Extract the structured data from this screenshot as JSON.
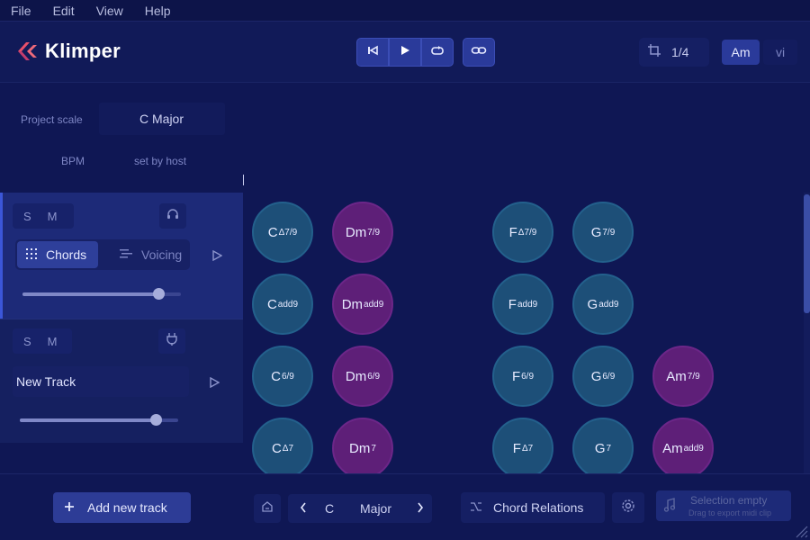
{
  "menu": [
    "File",
    "Edit",
    "View",
    "Help"
  ],
  "app": {
    "name": "Klimper"
  },
  "transport": {
    "quantize": "1/4",
    "keys": [
      "Am",
      "vi"
    ]
  },
  "project": {
    "scale_label": "Project scale",
    "scale_value": "C Major",
    "bpm_label": "BPM",
    "bpm_value": "set by host"
  },
  "tracks": [
    {
      "solo": "S",
      "mute": "M",
      "mode_on": "Chords",
      "mode_off": "Voicing",
      "volume": 0.86
    },
    {
      "solo": "S",
      "mute": "M",
      "name": "New Track",
      "volume": 0.86
    }
  ],
  "chords": [
    {
      "root": "C",
      "ext": "Δ7/9",
      "color": "teal"
    },
    {
      "root": "Dm",
      "ext": "7/9",
      "color": "purple"
    },
    {
      "root": "F",
      "ext": "Δ7/9",
      "color": "teal"
    },
    {
      "root": "G",
      "ext": "7/9",
      "color": "teal"
    },
    {
      "root": "C",
      "ext": "add9",
      "color": "teal"
    },
    {
      "root": "Dm",
      "ext": "add9",
      "color": "purple"
    },
    {
      "root": "F",
      "ext": "add9",
      "color": "teal"
    },
    {
      "root": "G",
      "ext": "add9",
      "color": "teal"
    },
    {
      "root": "C",
      "ext": "6/9",
      "color": "teal"
    },
    {
      "root": "Dm",
      "ext": "6/9",
      "color": "purple"
    },
    {
      "root": "F",
      "ext": "6/9",
      "color": "teal"
    },
    {
      "root": "G",
      "ext": "6/9",
      "color": "teal"
    },
    {
      "root": "Am",
      "ext": "7/9",
      "color": "purple"
    },
    {
      "root": "C",
      "ext": "Δ7",
      "color": "teal"
    },
    {
      "root": "Dm",
      "ext": "7",
      "color": "purple"
    },
    {
      "root": "F",
      "ext": "Δ7",
      "color": "teal"
    },
    {
      "root": "G",
      "ext": "7",
      "color": "teal"
    },
    {
      "root": "Am",
      "ext": "add9",
      "color": "purple"
    }
  ],
  "bottom": {
    "add_track": "Add new track",
    "key_root": "C",
    "key_mode": "Major",
    "relations": "Chord Relations",
    "export_title": "Selection empty",
    "export_hint": "Drag to export midi clip"
  },
  "colors": {
    "accent": "#2e3f9a",
    "teal": "#1d4f78",
    "purple": "#5e1f78",
    "bg": "#0f1754"
  }
}
